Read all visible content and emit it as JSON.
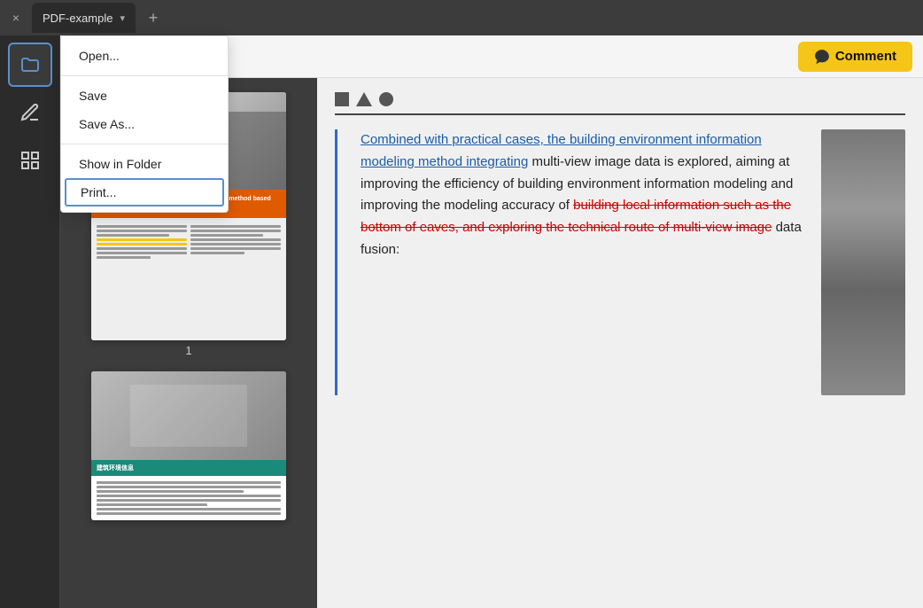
{
  "titlebar": {
    "close_label": "×",
    "tab_title": "PDF-example",
    "chevron": "▾",
    "add_label": "+"
  },
  "toolbar": {
    "bookmark_icon": "⊡",
    "comment_icon": "✏",
    "comment_label": "Comment"
  },
  "sidebar": {
    "items": [
      {
        "id": "folder",
        "icon": "🗂",
        "label": "Folder"
      },
      {
        "id": "annotation",
        "icon": "✍",
        "label": "Annotation"
      },
      {
        "id": "pages",
        "icon": "📋",
        "label": "Pages"
      }
    ]
  },
  "dropdown": {
    "items": [
      {
        "id": "open",
        "label": "Open..."
      },
      {
        "id": "save",
        "label": "Save"
      },
      {
        "id": "save-as",
        "label": "Save As..."
      },
      {
        "id": "show-in-folder",
        "label": "Show in Folder"
      },
      {
        "id": "print",
        "label": "Print..."
      }
    ]
  },
  "pdf": {
    "page1_num": "1",
    "page1_title": "Building environment information modeling method based on multi-view image",
    "article": {
      "paragraph1_highlighted": "Combined with practical cases, the building environment information modeling method integrating",
      "paragraph1_normal": " multi-view image data is explored, aiming at improving the efficiency of building environment information modeling and improving the modeling accuracy of ",
      "paragraph1_strikethrough": "building local information such as the bottom of eaves, and exploring the technical route of multi-view image",
      "paragraph1_end": " data fusion:"
    }
  },
  "shapes_bar": {
    "square": "■",
    "triangle": "▲",
    "circle": "●"
  }
}
